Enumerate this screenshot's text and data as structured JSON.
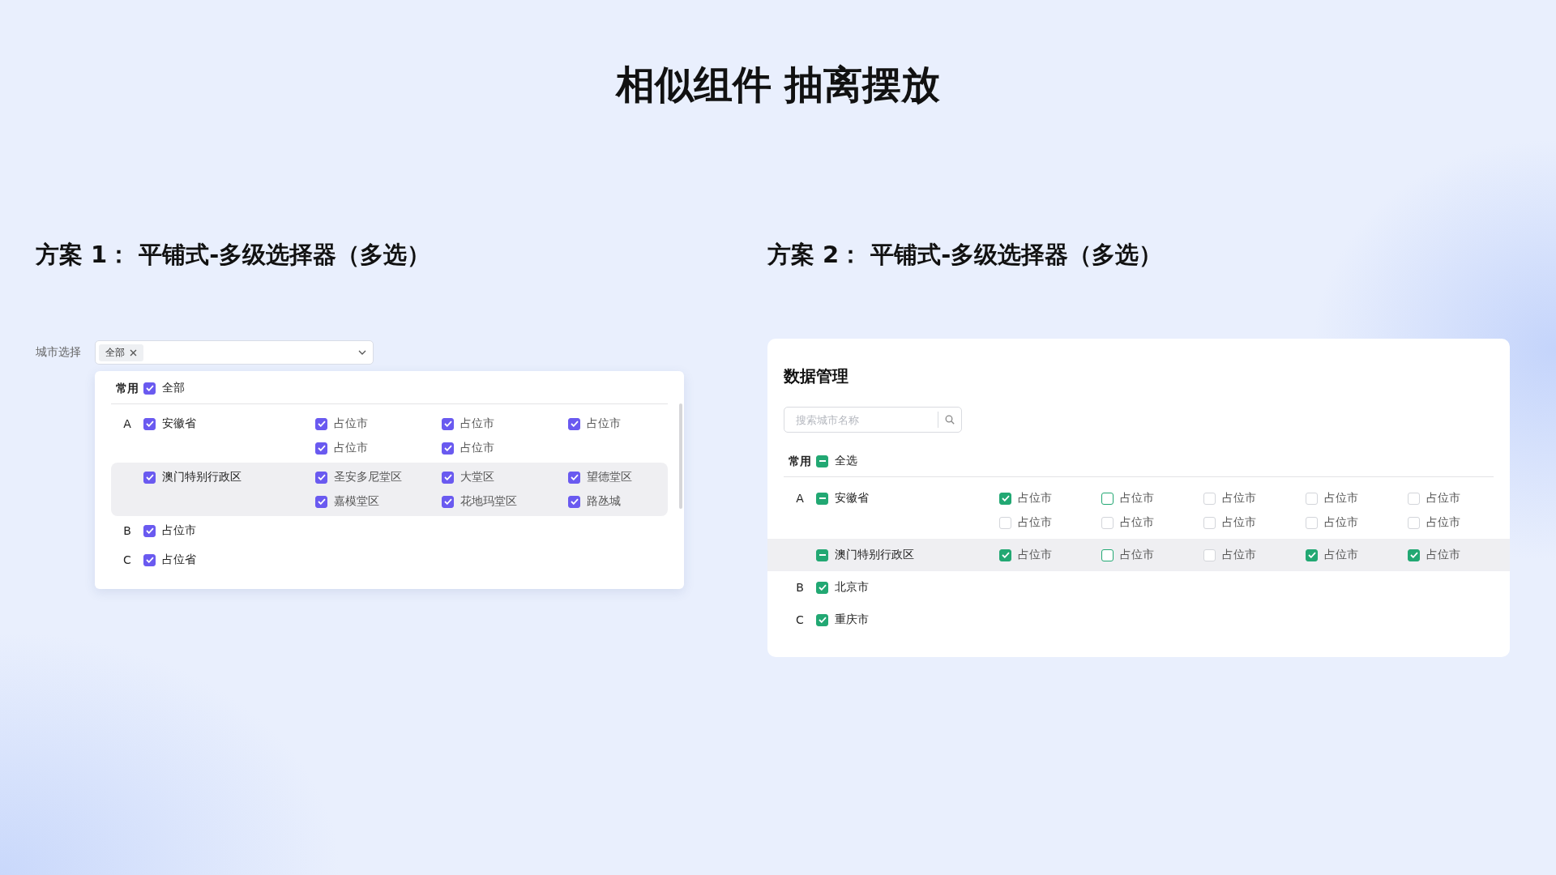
{
  "title": "相似组件 抽离摆放",
  "plan1": {
    "heading": "方案 1： 平铺式-多级选择器（多选）",
    "field_label": "城市选择",
    "tags": [
      {
        "label": "全部"
      }
    ],
    "dropdown": {
      "common": {
        "label": "常用",
        "option": {
          "label": "全部",
          "checked": true
        }
      },
      "groups": [
        {
          "letter": "A",
          "provinces": [
            {
              "label": "安徽省",
              "checked": true,
              "highlighted": false,
              "cities": [
                {
                  "label": "占位市",
                  "checked": true
                },
                {
                  "label": "占位市",
                  "checked": true
                },
                {
                  "label": "占位市",
                  "checked": true
                },
                {
                  "label": "占位市",
                  "checked": true
                },
                {
                  "label": "占位市",
                  "checked": true
                }
              ]
            },
            {
              "label": "澳门特别行政区",
              "checked": true,
              "highlighted": true,
              "cities": [
                {
                  "label": "圣安多尼堂区",
                  "checked": true
                },
                {
                  "label": "大堂区",
                  "checked": true
                },
                {
                  "label": "望德堂区",
                  "checked": true
                },
                {
                  "label": "嘉模堂区",
                  "checked": true
                },
                {
                  "label": "花地玛堂区",
                  "checked": true
                },
                {
                  "label": "路氹城",
                  "checked": true
                }
              ]
            }
          ]
        },
        {
          "letter": "B",
          "provinces": [
            {
              "label": "占位市",
              "checked": true,
              "highlighted": false
            }
          ]
        },
        {
          "letter": "C",
          "provinces": [
            {
              "label": "占位省",
              "checked": true,
              "highlighted": false
            }
          ]
        }
      ]
    }
  },
  "plan2": {
    "heading": "方案 2： 平铺式-多级选择器（多选）",
    "card": {
      "title": "数据管理",
      "search": {
        "placeholder": "搜索城市名称"
      },
      "common": {
        "label": "常用",
        "option": {
          "label": "全选",
          "checked": true,
          "indeterminate": true
        }
      },
      "groups": [
        {
          "letter": "A",
          "provinces": [
            {
              "label": "安徽省",
              "checked": true,
              "indeterminate": true,
              "highlighted": false,
              "cities": [
                {
                  "label": "占位市",
                  "checked": true,
                  "color": "#22a873"
                },
                {
                  "label": "占位市",
                  "checked": false,
                  "color": "#22a873"
                },
                {
                  "label": "占位市",
                  "checked": false,
                  "color": "#d3d5da"
                },
                {
                  "label": "占位市",
                  "checked": false,
                  "color": "#d3d5da"
                },
                {
                  "label": "占位市",
                  "checked": false,
                  "color": "#d3d5da"
                },
                {
                  "label": "占位市",
                  "checked": false,
                  "color": "#d3d5da"
                },
                {
                  "label": "占位市",
                  "checked": false,
                  "color": "#d3d5da"
                },
                {
                  "label": "占位市",
                  "checked": false,
                  "color": "#d3d5da"
                },
                {
                  "label": "占位市",
                  "checked": false,
                  "color": "#d3d5da"
                },
                {
                  "label": "占位市",
                  "checked": false,
                  "color": "#d3d5da"
                }
              ]
            },
            {
              "label": "澳门特别行政区",
              "checked": true,
              "indeterminate": true,
              "highlighted": true,
              "cities": [
                {
                  "label": "占位市",
                  "checked": true,
                  "color": "#22a873"
                },
                {
                  "label": "占位市",
                  "checked": false,
                  "color": "#22a873"
                },
                {
                  "label": "占位市",
                  "checked": false,
                  "color": "#d3d5da"
                },
                {
                  "label": "占位市",
                  "checked": true,
                  "color": "#22a873"
                },
                {
                  "label": "占位市",
                  "checked": true,
                  "color": "#22a873"
                }
              ]
            }
          ]
        },
        {
          "letter": "B",
          "provinces": [
            {
              "label": "北京市",
              "checked": true,
              "indeterminate": false,
              "highlighted": false
            }
          ]
        },
        {
          "letter": "C",
          "provinces": [
            {
              "label": "重庆市",
              "checked": true,
              "indeterminate": false,
              "highlighted": false
            }
          ]
        }
      ]
    }
  }
}
